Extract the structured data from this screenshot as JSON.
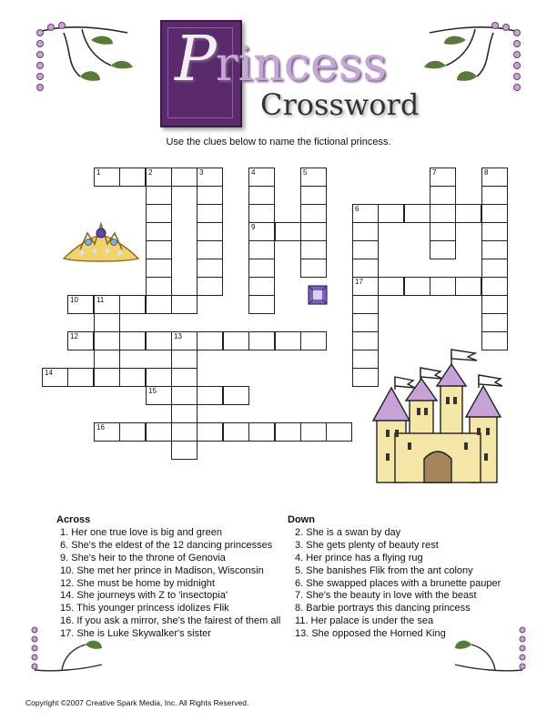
{
  "header": {
    "title_initial": "P",
    "title_rest": "rincess",
    "subtitle": "Crossword",
    "instructions": "Use the clues below to name the fictional princess."
  },
  "grid": {
    "numbers": [
      "1",
      "2",
      "3",
      "4",
      "5",
      "6",
      "7",
      "8",
      "9",
      "10",
      "11",
      "12",
      "13",
      "14",
      "15",
      "16",
      "17"
    ]
  },
  "clues": {
    "across_heading": "Across",
    "down_heading": "Down",
    "across": [
      "1. Her one true love is big and green",
      "6. She's the eldest of the 12 dancing princesses",
      "9. She's heir to the throne of Genovia",
      "10. She met her prince in Madison, Wisconsin",
      "12. She must be home by midnight",
      "14. She journeys with Z to 'insectopia'",
      "15. This younger princess idolizes Flik",
      "16. If you ask a mirror, she's the fairest of them all",
      "17. She is Luke Skywalker's sister"
    ],
    "down": [
      "2. She is a swan by day",
      "3. She gets plenty of beauty rest",
      "4. Her prince has a flying rug",
      "5. She banishes Flik from the ant colony",
      "6. She swapped places with a brunette pauper",
      "7. She's the beauty in love with the beast",
      "8. Barbie portrays this dancing princess",
      "11. Her palace is under the sea",
      "13. She opposed the Horned King"
    ]
  },
  "footer": {
    "copyright": "Copyright ©2007  Creative Spark Media, Inc.  All Rights Reserved."
  },
  "colors": {
    "plate": "#5a2a6c",
    "vine": "#3b5a2a",
    "bead": "#b98fc2",
    "castle_wall": "#f4e6a6",
    "castle_roof": "#c7a2d6"
  }
}
